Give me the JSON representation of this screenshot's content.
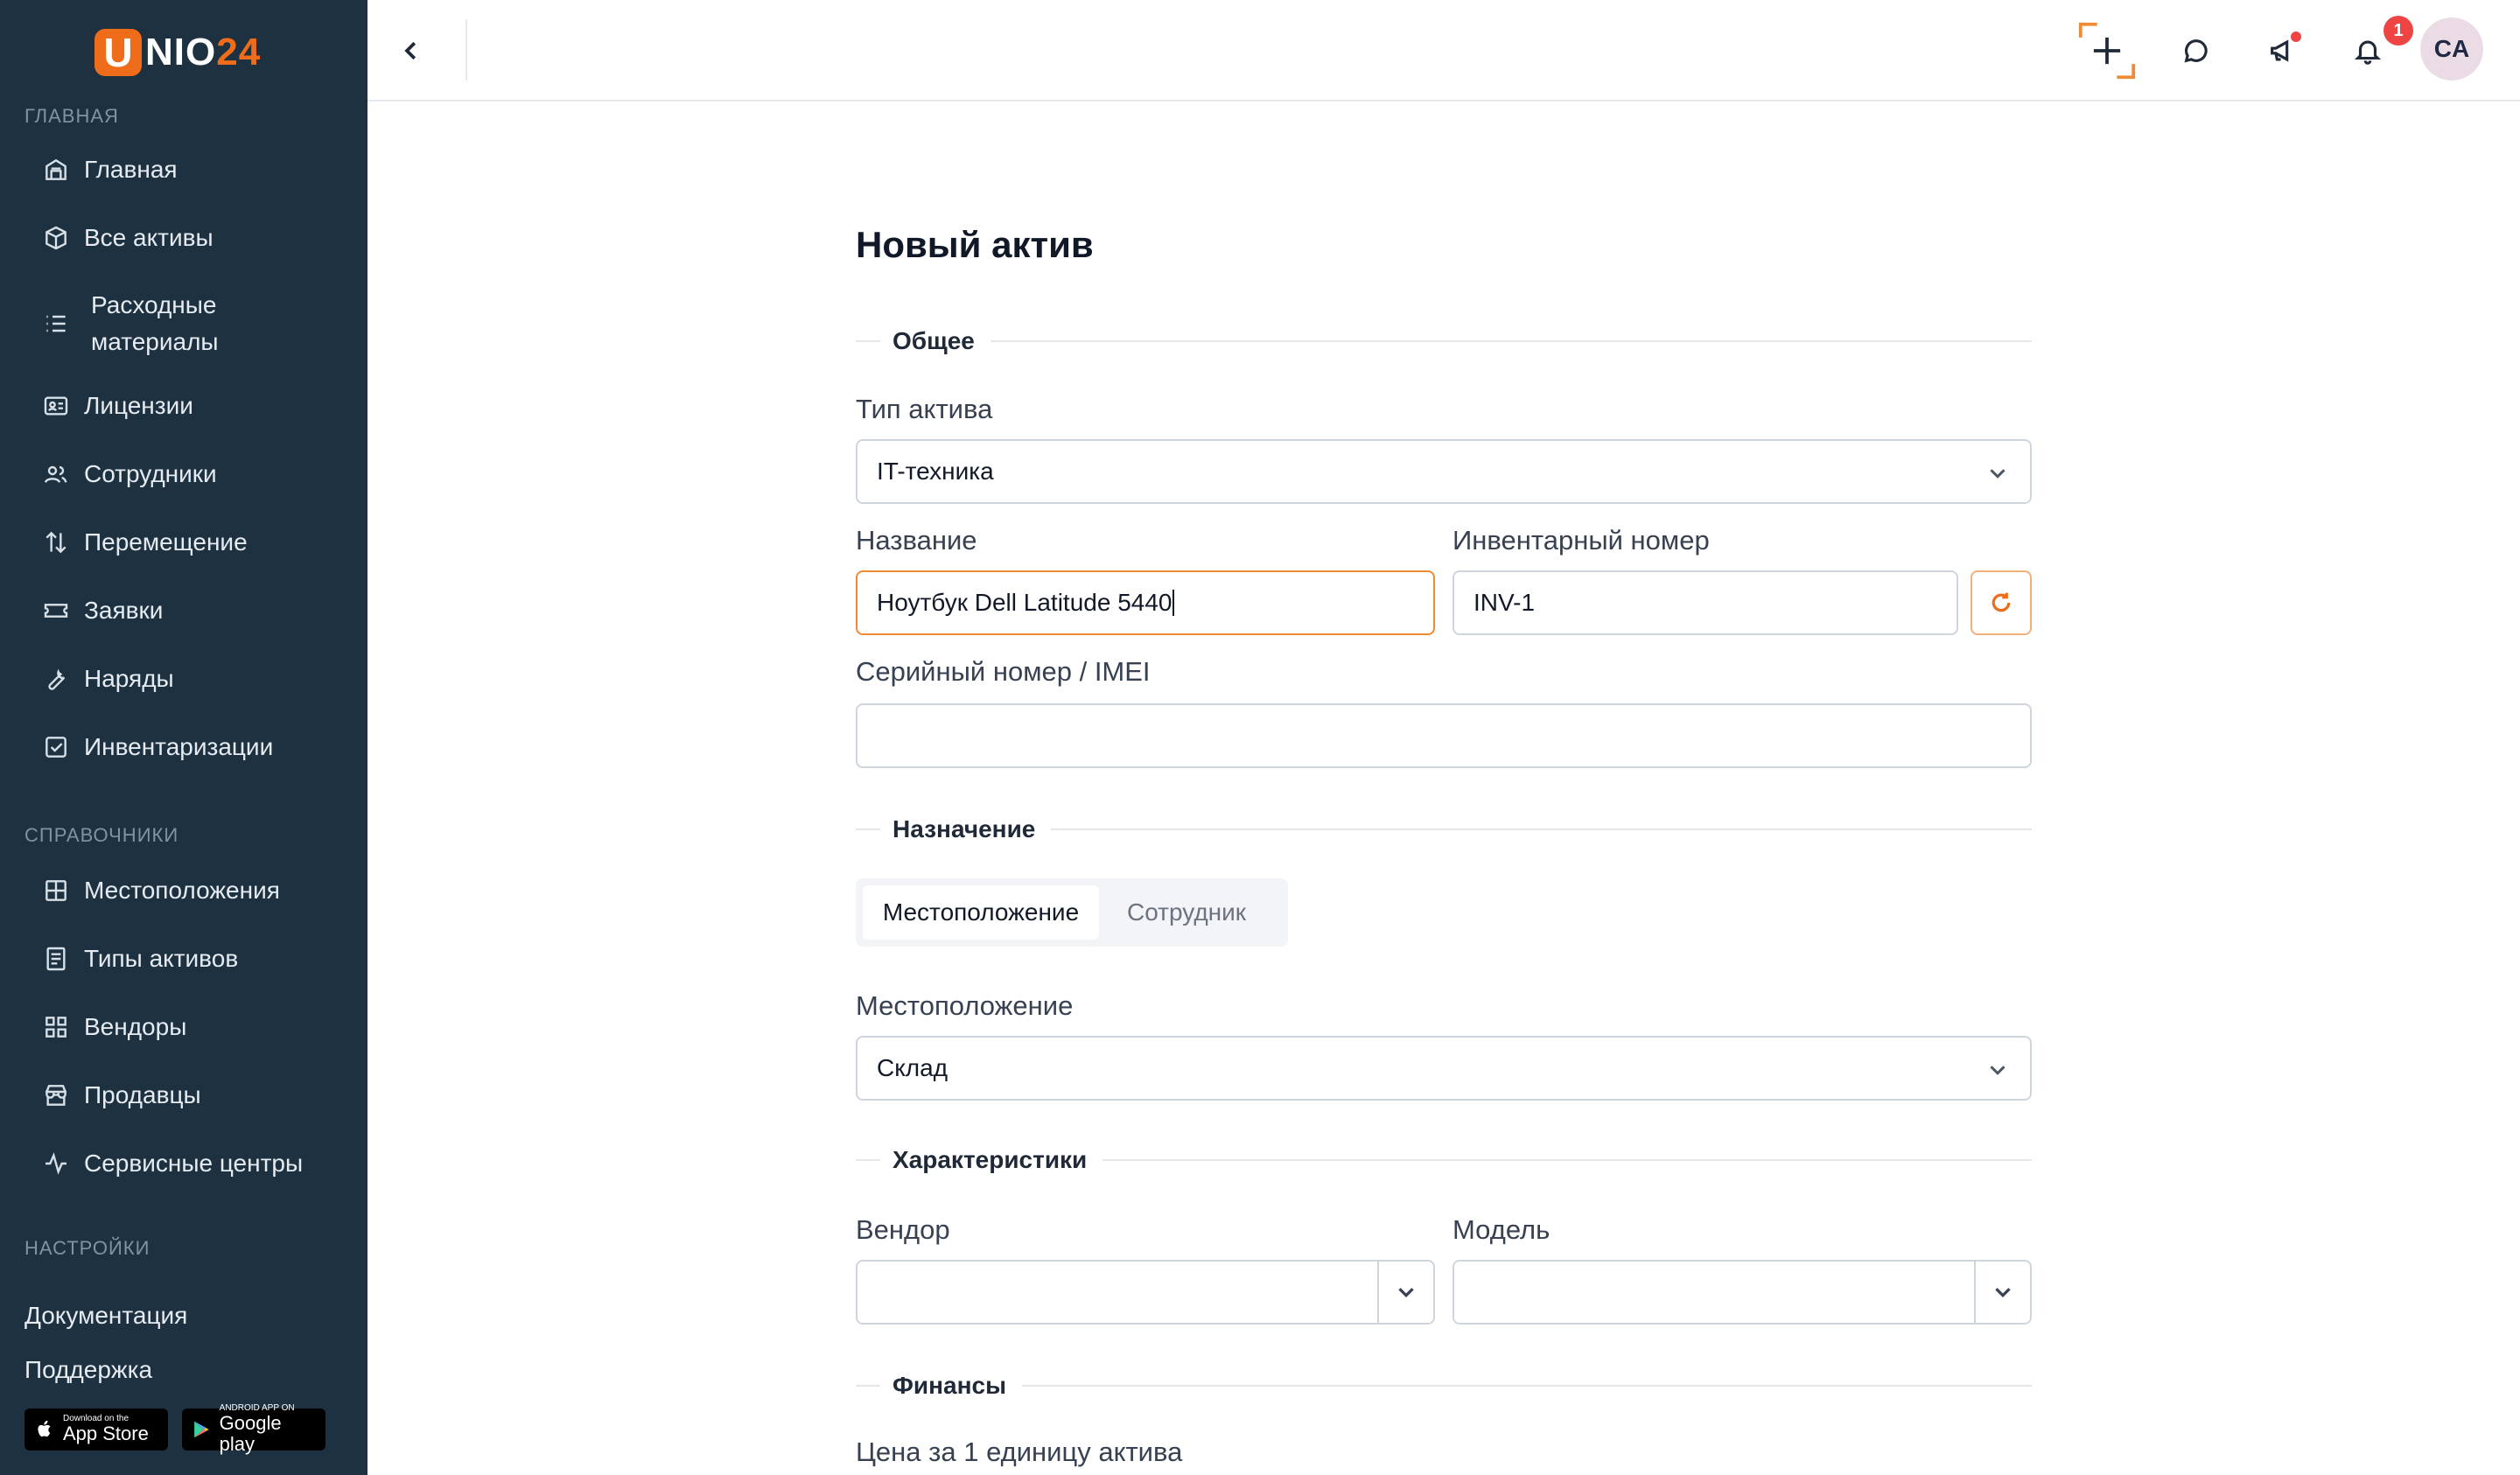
{
  "brand": {
    "logo_letter": "U",
    "logo_text_main": "NIO",
    "logo_text_num": "24",
    "accent": "#ef6c1a",
    "sidebar_bg": "#1d3140"
  },
  "sidebar": {
    "section_main": "ГЛАВНАЯ",
    "main_items": [
      {
        "label": "Главная",
        "icon": "building-icon"
      },
      {
        "label": "Все активы",
        "icon": "box-icon"
      },
      {
        "label": "Расходные материалы",
        "label_line1": "Расходные",
        "label_line2": "материалы",
        "icon": "list-icon"
      },
      {
        "label": "Лицензии",
        "icon": "id-card-icon"
      },
      {
        "label": "Сотрудники",
        "icon": "users-icon"
      },
      {
        "label": "Перемещение",
        "icon": "arrows-updown-icon"
      },
      {
        "label": "Заявки",
        "icon": "ticket-icon"
      },
      {
        "label": "Наряды",
        "icon": "wrench-icon"
      },
      {
        "label": "Инвентаризации",
        "icon": "checkbox-icon"
      }
    ],
    "section_refs": "СПРАВОЧНИКИ",
    "ref_items": [
      {
        "label": "Местоположения",
        "icon": "grid-icon"
      },
      {
        "label": "Типы активов",
        "icon": "document-icon"
      },
      {
        "label": "Вендоры",
        "icon": "blocks-icon"
      },
      {
        "label": "Продавцы",
        "icon": "store-icon"
      },
      {
        "label": "Сервисные центры",
        "icon": "activity-icon"
      }
    ],
    "section_settings": "НАСТРОЙКИ",
    "links": {
      "docs": "Документация",
      "support": "Поддержка"
    },
    "app_store": {
      "small": "Download on the",
      "big": "App Store"
    },
    "google_play": {
      "small": "ANDROID APP ON",
      "big": "Google play"
    }
  },
  "header": {
    "notifications_count": "1",
    "avatar_initials": "CA"
  },
  "form": {
    "title": "Новый актив",
    "section_general": "Общее",
    "asset_type": {
      "label": "Тип актива",
      "value": "IT-техника"
    },
    "name": {
      "label": "Название",
      "value": "Ноутбук Dell Latitude 5440"
    },
    "inventory": {
      "label": "Инвентарный номер",
      "value": "INV-1"
    },
    "serial": {
      "label": "Серийный номер / IMEI",
      "value": ""
    },
    "section_assignment": "Назначение",
    "assignment_tabs": {
      "location": "Местоположение",
      "employee": "Сотрудник",
      "active": "location"
    },
    "location": {
      "label": "Местоположение",
      "value": "Склад"
    },
    "section_specs": "Характеристики",
    "vendor": {
      "label": "Вендор",
      "value": ""
    },
    "model": {
      "label": "Модель",
      "value": ""
    },
    "section_finance": "Финансы",
    "price": {
      "label": "Цена за 1 единицу актива"
    }
  }
}
